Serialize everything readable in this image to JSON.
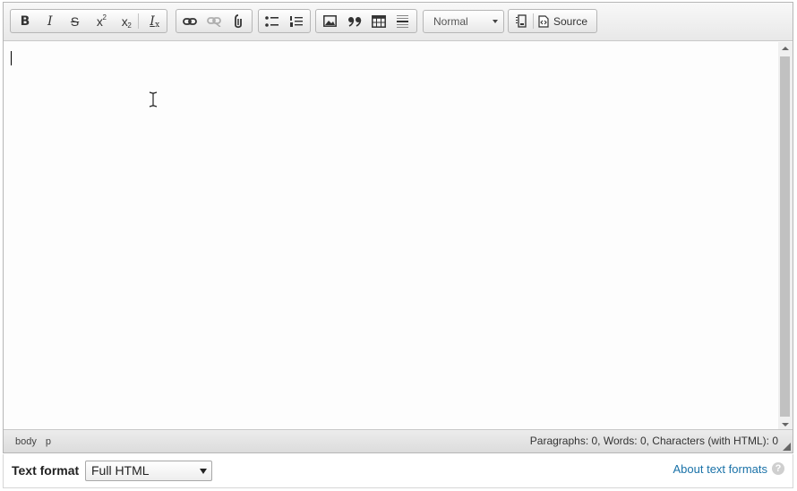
{
  "toolbar": {
    "bold": "B",
    "italic": "I",
    "strike": "S",
    "superscript": "x",
    "superscript_mark": "2",
    "subscript": "x",
    "subscript_mark": "2",
    "remove_format": "I",
    "remove_format_mark": "x",
    "format_combo": "Normal",
    "source_label": "Source"
  },
  "statusbar": {
    "path": [
      "body",
      "p"
    ],
    "stats": "Paragraphs: 0, Words: 0, Characters (with HTML): 0"
  },
  "text_format": {
    "label": "Text format",
    "selected": "Full HTML",
    "about_link": "About text formats",
    "help": "?"
  },
  "icons": {
    "link": "link-icon",
    "unlink": "unlink-icon",
    "anchor": "anchor-icon",
    "bulleted_list": "bulleted-list-icon",
    "numbered_list": "numbered-list-icon",
    "image": "image-icon",
    "blockquote": "blockquote-icon",
    "table": "table-icon",
    "horizontal_rule": "horizontal-rule-icon",
    "show_blocks": "show-blocks-icon",
    "source": "source-icon"
  }
}
